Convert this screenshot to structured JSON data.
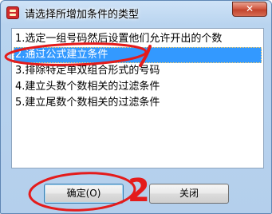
{
  "window": {
    "title": "请选择所增加条件的类型",
    "close_symbol": "✕"
  },
  "list": {
    "items": [
      {
        "label": "1.选定一组号码然后设置他们允许开出的个数",
        "selected": false
      },
      {
        "label": "2.通过公式建立条件",
        "selected": true
      },
      {
        "label": "3.排除特定单双组合形式的号码",
        "selected": false
      },
      {
        "label": "4.建立头数个数相关的过滤条件",
        "selected": false
      },
      {
        "label": "5.建立尾数个数相关的过滤条件",
        "selected": false
      }
    ]
  },
  "buttons": {
    "ok_label": "确定(O)",
    "close_label": "关闭"
  },
  "annotations": {
    "mark_1": "1",
    "mark_2": "2",
    "color": "#e41b1b"
  }
}
